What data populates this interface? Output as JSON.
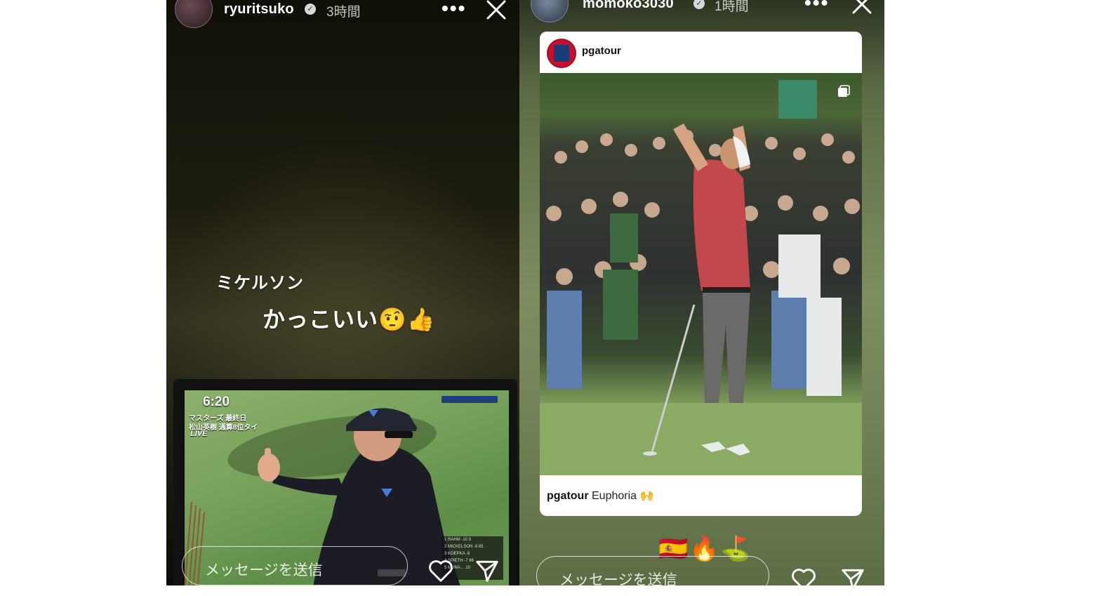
{
  "stories": [
    {
      "username": "ryuritsuko",
      "verified_icon": "verified-badge-icon",
      "time": "3時間",
      "more_icon": "•••",
      "caption_line1": "ミケルソン",
      "caption_line2": "かっこいい🤨👍",
      "tv": {
        "clock": "6:20",
        "line1": "マスターズ 最終日",
        "line2": "松山英樹 通算8位タイ",
        "live": "LIVE",
        "leaderboard": [
          "1 RAHM -10 9",
          "2 MICKELSON -8 65",
          "3 KOEPKA -8",
          "4 SPIETH -7 66",
          "5 MUNA… 10"
        ]
      },
      "message_placeholder": "メッセージを送信"
    },
    {
      "username": "momoko3030",
      "verified_icon": "verified-badge-icon",
      "time": "1時間",
      "more_icon": "•••",
      "shared_post": {
        "username": "pgatour",
        "caption_user": "pgatour",
        "caption_text": "Euphoria 🙌"
      },
      "emojis": "🇪🇸🔥⛳",
      "message_placeholder": "メッセージを送信"
    }
  ],
  "colors": {
    "verified": "#d8d8d8",
    "pga_red": "#c8102e",
    "pga_blue": "#1a3a78"
  }
}
